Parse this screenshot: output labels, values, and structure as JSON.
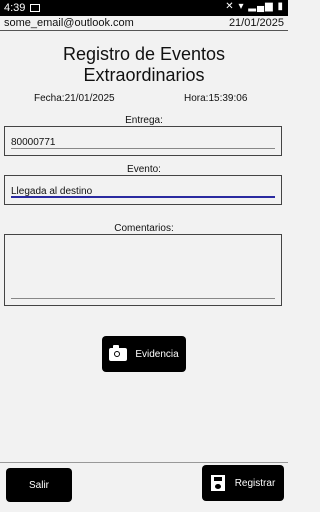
{
  "status": {
    "time": "4:39"
  },
  "header": {
    "email": "some_email@outlook.com",
    "date": "21/01/2025"
  },
  "title": "Registro de Eventos Extraordinarios",
  "meta": {
    "fecha": "Fecha:21/01/2025",
    "hora": "Hora:15:39:06"
  },
  "form": {
    "entrega": {
      "label": "Entrega:",
      "value": "80000771"
    },
    "evento": {
      "label": "Evento:",
      "value": "Llegada al destino"
    },
    "comentarios": {
      "label": "Comentarios:",
      "value": ""
    }
  },
  "buttons": {
    "evidencia": "Evidencia",
    "salir": "Salir",
    "registrar": "Registrar"
  },
  "colors": {
    "accent_underline": "#2a2aa0",
    "button_bg": "#000000"
  }
}
